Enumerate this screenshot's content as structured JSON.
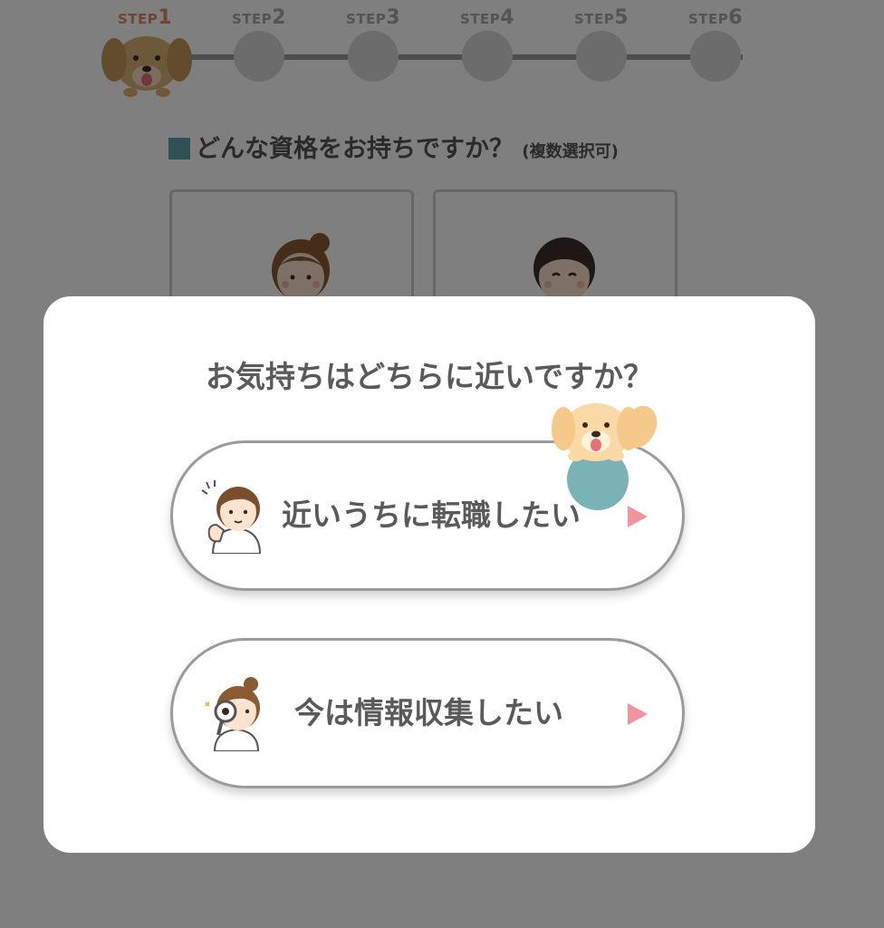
{
  "steps": {
    "prefix": "STEP",
    "items": [
      {
        "number": "1",
        "state": "current"
      },
      {
        "number": "2",
        "state": "upcoming"
      },
      {
        "number": "3",
        "state": "upcoming"
      },
      {
        "number": "4",
        "state": "upcoming"
      },
      {
        "number": "5",
        "state": "upcoming"
      },
      {
        "number": "6",
        "state": "upcoming"
      }
    ]
  },
  "question": {
    "title": "どんな資格をお持ちですか？",
    "sub": "(複数選択可)"
  },
  "modal": {
    "title": "お気持ちはどちらに近いですか？",
    "options": [
      {
        "label": "近いうちに転職したい",
        "icon": "nurse-man-thumbs-icon"
      },
      {
        "label": "今は情報収集したい",
        "icon": "nurse-woman-magnifier-icon"
      }
    ]
  },
  "colors": {
    "accent_step": "#e0866a",
    "question_marker": "#5fa3ad",
    "arrow": "#f2939d",
    "ball": "#7ab3b6",
    "overlay": "rgba(0,0,0,0.5)"
  }
}
